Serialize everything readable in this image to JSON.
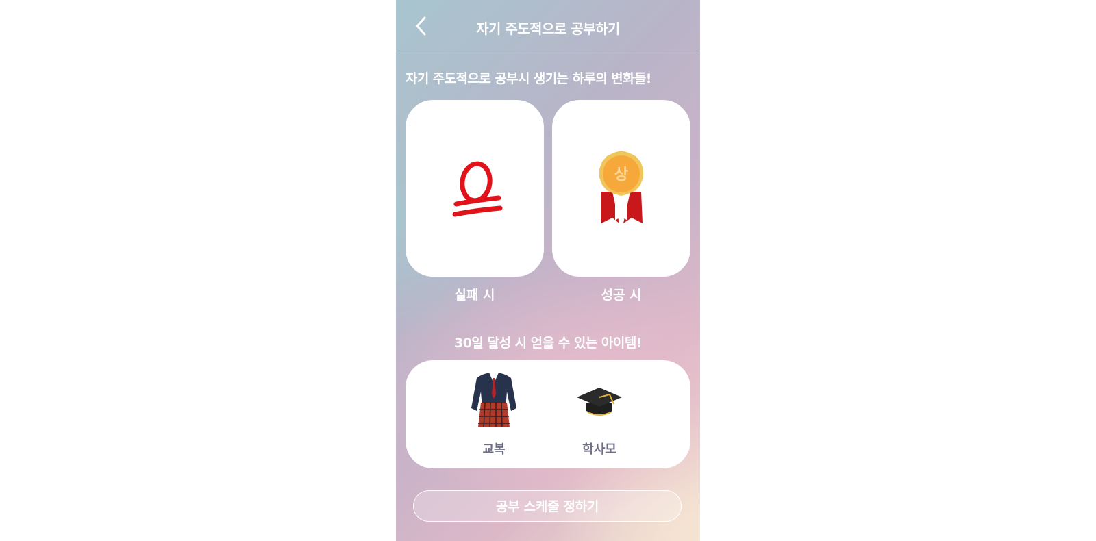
{
  "header": {
    "title": "자기 주도적으로 공부하기",
    "back_icon": "chevron-left-icon"
  },
  "changes": {
    "title": "자기 주도적으로 공부시 생기는 하루의 변화들!",
    "fail": {
      "label": "실패 시",
      "icon": "stamp-eu-icon"
    },
    "success": {
      "label": "성공 시",
      "icon": "medal-icon",
      "medal_text": "상"
    }
  },
  "rewards": {
    "title": "30일 달성 시 얻을 수 있는 아이템!",
    "items": [
      {
        "label": "교복",
        "icon": "school-uniform-icon"
      },
      {
        "label": "학사모",
        "icon": "graduation-cap-icon"
      }
    ]
  },
  "schedule_button": {
    "label": "공부 스케줄 정하기"
  },
  "colors": {
    "stamp_red": "#e0131b",
    "medal_gold": "#f0c65a",
    "medal_orange": "#f6a93a",
    "ribbon_red": "#c8181c",
    "label_gray": "#6f6f86"
  }
}
